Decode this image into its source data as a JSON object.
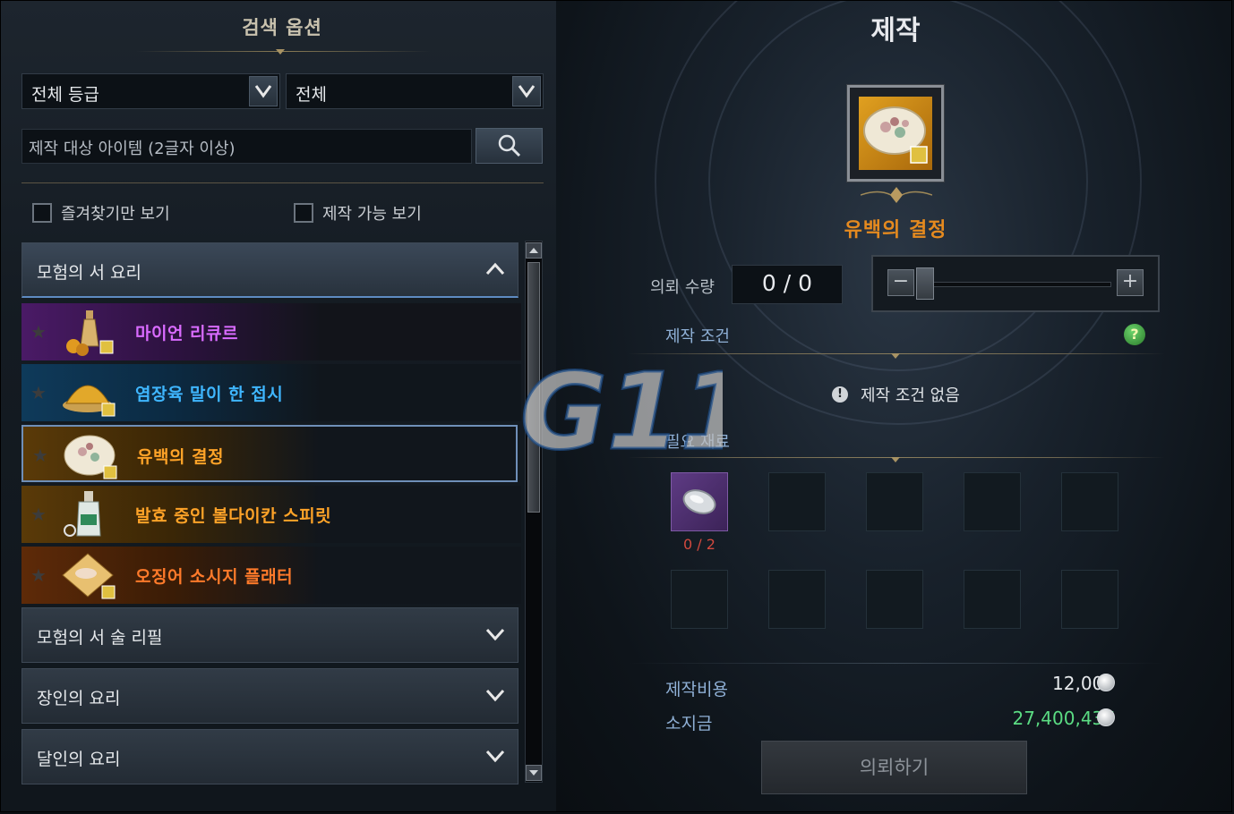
{
  "search_options": {
    "title": "검색 옵션",
    "grade_select": {
      "value": "전체 등급"
    },
    "type_select": {
      "value": "전체"
    },
    "search_input": {
      "placeholder": "제작 대상 아이템 (2글자 이상)"
    },
    "favorites_only_label": "즐겨찾기만 보기",
    "craftable_only_label": "제작 가능 보기"
  },
  "categories": [
    {
      "label": "모험의 서 요리",
      "expanded": true
    },
    {
      "label": "모험의 서 술 리필",
      "expanded": false
    },
    {
      "label": "장인의 요리",
      "expanded": false
    },
    {
      "label": "달인의 요리",
      "expanded": false
    }
  ],
  "recipes": [
    {
      "name": "마이언 리큐르",
      "color": "#d96bff",
      "bg": "#4a1a66",
      "icon": "liqueur-icon"
    },
    {
      "name": "염장육 말이 한 접시",
      "color": "#3fb6ff",
      "bg": "#0e3a5a",
      "icon": "meat-roll-dish-icon"
    },
    {
      "name": "유백의 결정",
      "color": "#ffa328",
      "bg": "#5a3a08",
      "icon": "white-crystal-dish-icon",
      "selected": true
    },
    {
      "name": "발효 중인 볼다이칸 스피릿",
      "color": "#ffa328",
      "bg": "#5a3a08",
      "icon": "spirit-bottle-icon"
    },
    {
      "name": "오징어 소시지 플래터",
      "color": "#ff7a2a",
      "bg": "#5e2a08",
      "icon": "squid-sausage-platter-icon"
    }
  ],
  "craft": {
    "title": "제작",
    "item_name": "유백의 결정",
    "qty_label": "의뢰 수량",
    "qty_value": "0 / 0",
    "condition_label": "제작 조건",
    "condition_help": "?",
    "condition_text": "제작 조건 없음",
    "materials_label": "필요 재료",
    "material_count": "0 / 2",
    "cost_label": "제작비용",
    "cost_value": "12,000",
    "cost_color": "#e6e9ec",
    "money_label": "소지금",
    "money_value": "27,400,437",
    "money_color": "#5bdc83",
    "commission_button": "의뢰하기"
  },
  "watermark": "G11"
}
